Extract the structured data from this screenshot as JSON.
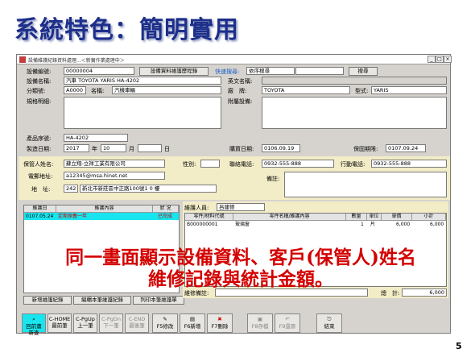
{
  "slide_title": "系統特色：簡明實用",
  "window": {
    "title": "設備維護紀錄資料處理...＜新竇作業處理中＞",
    "min": "_",
    "max": "□",
    "close": "×"
  },
  "form": {
    "equip_no_label": "設備編號:",
    "equip_no": "00000004",
    "history_btn": "設備資料維護歷程錄",
    "quick_search_label": "快速搜尋:",
    "quick_search_value": "依序搜尋",
    "search_btn": "搜尋",
    "equip_name_label": "設備名稱:",
    "equip_name": "汽車 TOYOTA YARIS HA-4202",
    "en_name_label": "英文名稱:",
    "category_label": "分類號:",
    "category_code": "A0000",
    "name_label": "名稱:",
    "name_value": "汽機車輛",
    "factory_label": "廠　牌:",
    "factory_value": "TOYOTA",
    "model_label": "型式:",
    "model_value": "YARIS",
    "spec_label": "規格明細:",
    "accessory_label": "附屬設備:",
    "serial_label": "產品序號:",
    "serial_value": "HA-4202",
    "mfg_label": "製造日期:",
    "mfg_year": "2017",
    "mfg_year_unit": "年",
    "mfg_month": "10",
    "mfg_month_unit": "月",
    "mfg_day_unit": "日",
    "buy_label": "購買日期:",
    "buy_value": "0106.09.19",
    "warranty_label": "保固期限:",
    "warranty_value": "0107.09.24"
  },
  "owner": {
    "name_label": "保管人姓名:",
    "name_value": "蘇立翔-立祥工業有限公司",
    "gender_label": "性別:",
    "phone_label": "聯絡電話:",
    "phone_value": "0932-555-888",
    "mobile_label": "行動電話:",
    "mobile_value": "0932-555-888",
    "email_label": "電郵地址:",
    "email_value": "a12345@msa.hinet.net",
    "note_label": "備註:",
    "addr_label": "地　址:",
    "zip": "242",
    "addr": "新北市新莊區中正路100號1 0 樓"
  },
  "left_grid": {
    "headers": [
      "維護日",
      "維護內容",
      "狀 況"
    ],
    "rows": [
      {
        "date": "0107.05.24",
        "content": "定期保養一年",
        "status": "已完成"
      }
    ]
  },
  "right_grid": {
    "staff_label": "維護人員:",
    "staff_value": "呂建德",
    "headers": [
      "零件/材料代號",
      "零件名稱/維護內容",
      "數量",
      "單位",
      "單價",
      "小計"
    ],
    "rows": [
      {
        "code": "B000000001",
        "name": "玻璃窗",
        "qty": "1",
        "unit": "片",
        "price": "6,000",
        "subtotal": "6,000"
      }
    ],
    "note_label": "維修備註:",
    "total_label": "總　計:",
    "total_value": "6,000"
  },
  "left_buttons": [
    "新增維護紀錄",
    "編輯本筆維護紀錄",
    "列印本筆維護單"
  ],
  "toolbar": [
    {
      "label": "回前畫\n新查",
      "icon": "search-icon"
    },
    {
      "label": "C-HOME\n最前筆",
      "icon": "first-icon"
    },
    {
      "label": "C-PgUp\n上一筆",
      "icon": "prev-icon"
    },
    {
      "label": "C-PgDn\n下一筆",
      "icon": "next-icon"
    },
    {
      "label": "C-END\n最後筆",
      "icon": "last-icon"
    },
    {
      "label": "F5修改",
      "icon": "edit-icon"
    },
    {
      "label": "F6新增",
      "icon": "add-icon"
    },
    {
      "label": "F7刪除",
      "icon": "delete-icon"
    },
    {
      "label": "F8存檔",
      "icon": "save-icon"
    },
    {
      "label": "F9還原",
      "icon": "undo-icon"
    },
    {
      "label": "結束",
      "icon": "exit-icon"
    }
  ],
  "overlay_line1": "同一畫面顯示設備資料、客戶(保管人)姓名",
  "overlay_line2": "維修記錄與統計金額。",
  "page_number": "5"
}
